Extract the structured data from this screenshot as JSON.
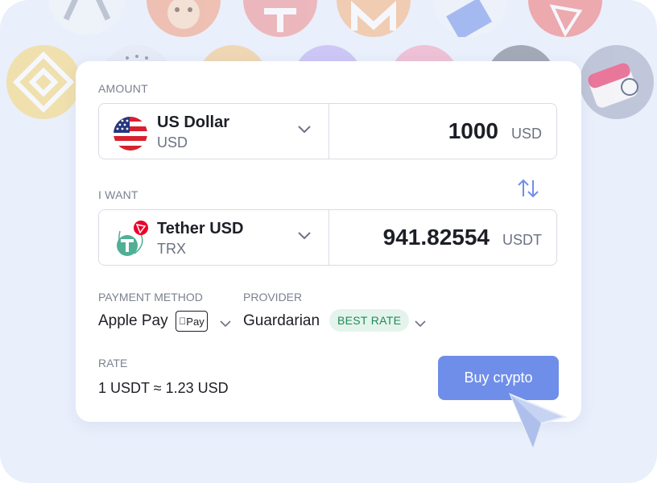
{
  "amount_section": {
    "label": "AMOUNT",
    "asset_name": "US Dollar",
    "asset_ticker": "USD",
    "value": "1000",
    "currency": "USD"
  },
  "want_section": {
    "label": "I WANT",
    "asset_name": "Tether USD",
    "asset_ticker": "TRX",
    "value": "941.82554",
    "currency": "USDT"
  },
  "payment": {
    "label": "PAYMENT METHOD",
    "value": "Apple Pay",
    "badge_text": "Pay"
  },
  "provider": {
    "label": "PROVIDER",
    "value": "Guardarian",
    "badge": "BEST RATE"
  },
  "rate": {
    "label": "RATE",
    "value": "1 USDT ≈ 1.23 USD"
  },
  "buy_button": {
    "label": "Buy crypto"
  },
  "colors": {
    "accent": "#6f8ee9",
    "background": "#e9effb",
    "badge_bg": "#e4f4ec",
    "badge_text": "#1f8a55",
    "tether_green": "#50af95",
    "tron_red": "#eb0029"
  },
  "background_coins": [
    "shiba-inu-icon",
    "tether-icon",
    "monero-icon",
    "tron-icon",
    "binance-icon",
    "sushi-icon"
  ]
}
